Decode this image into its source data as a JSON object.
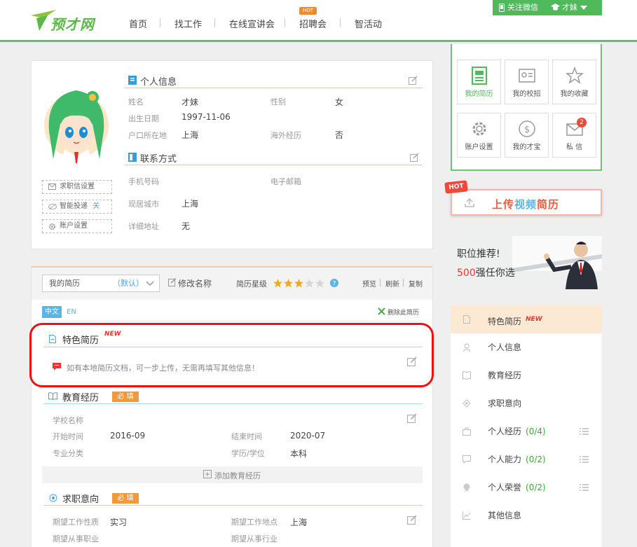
{
  "header": {
    "logo_text": "预才网",
    "nav": [
      "首页",
      "找工作",
      "在线宣讲会",
      "招聘会",
      "智活动"
    ],
    "hot_badge": "HOT",
    "follow_wechat": "关注微信",
    "user_name": "才妹"
  },
  "profile": {
    "personal_title": "个人信息",
    "fields": {
      "name_label": "姓名",
      "name_value": "才妹",
      "gender_label": "性别",
      "gender_value": "女",
      "birth_label": "出生日期",
      "birth_value": "1997-11-06",
      "hukou_label": "户口所在地",
      "hukou_value": "上海",
      "overseas_label": "海外经历",
      "overseas_value": "否"
    },
    "contact_title": "联系方式",
    "contact": {
      "phone_label": "手机号码",
      "email_label": "电子邮箱",
      "city_label": "现居城市",
      "city_value": "上海",
      "address_label": "详细地址",
      "address_value": "无"
    },
    "side_buttons": {
      "job_letter": "求职信设置",
      "smart_send": "智能投递",
      "smart_send_state": "关",
      "account": "账户设置"
    }
  },
  "resume": {
    "select_value": "我的简历",
    "select_default": "（默认）",
    "rename": "修改名称",
    "star_label": "简历星级",
    "stars_filled": 3,
    "stars_total": 5,
    "preview": "预览",
    "refresh": "刷新",
    "copy": "复制",
    "lang_cn": "中文",
    "lang_en": "EN",
    "delete": "删除此简历",
    "featured_title": "特色简历",
    "featured_new": "NEW",
    "featured_tip": "如有本地简历文档，可一步上传，无需再填写其他信息！",
    "edu_title": "教育经历",
    "required": "必 填",
    "edu": {
      "school_label": "学校名称",
      "start_label": "开始时间",
      "start_value": "2016-09",
      "end_label": "结束时间",
      "end_value": "2020-07",
      "major_label": "专业分类",
      "degree_label": "学历/学位",
      "degree_value": "本科"
    },
    "add_edu": "添加教育经历",
    "intent_title": "求职意向",
    "intent": {
      "type_label": "期望工作性质",
      "type_value": "实习",
      "place_label": "期望工作地点",
      "place_value": "上海",
      "industry_label": "期望从事职业",
      "field_label": "期望从事行业"
    }
  },
  "right": {
    "grid": [
      "我的简历",
      "我的校招",
      "我的收藏",
      "账户设置",
      "我的才宝",
      "私 信"
    ],
    "message_badge": "2",
    "upload_hot": "HOT",
    "upload_a": "上传",
    "upload_b": "视频",
    "upload_c": "简历",
    "banner_line1": "职位推荐!",
    "banner_num": "500",
    "banner_line2": "强任你选",
    "menu": [
      {
        "label": "特色简历",
        "badge": "NEW"
      },
      {
        "label": "个人信息"
      },
      {
        "label": "教育经历"
      },
      {
        "label": "求职意向"
      },
      {
        "label": "个人经历",
        "count": "(0/4)"
      },
      {
        "label": "个人能力",
        "count": "(0/2)"
      },
      {
        "label": "个人荣誉",
        "count": "(0/2)"
      },
      {
        "label": "其他信息"
      }
    ]
  },
  "colors": {
    "brand_green": "#4fb95b",
    "accent_orange": "#f29a3b",
    "highlight_red": "#e11"
  }
}
